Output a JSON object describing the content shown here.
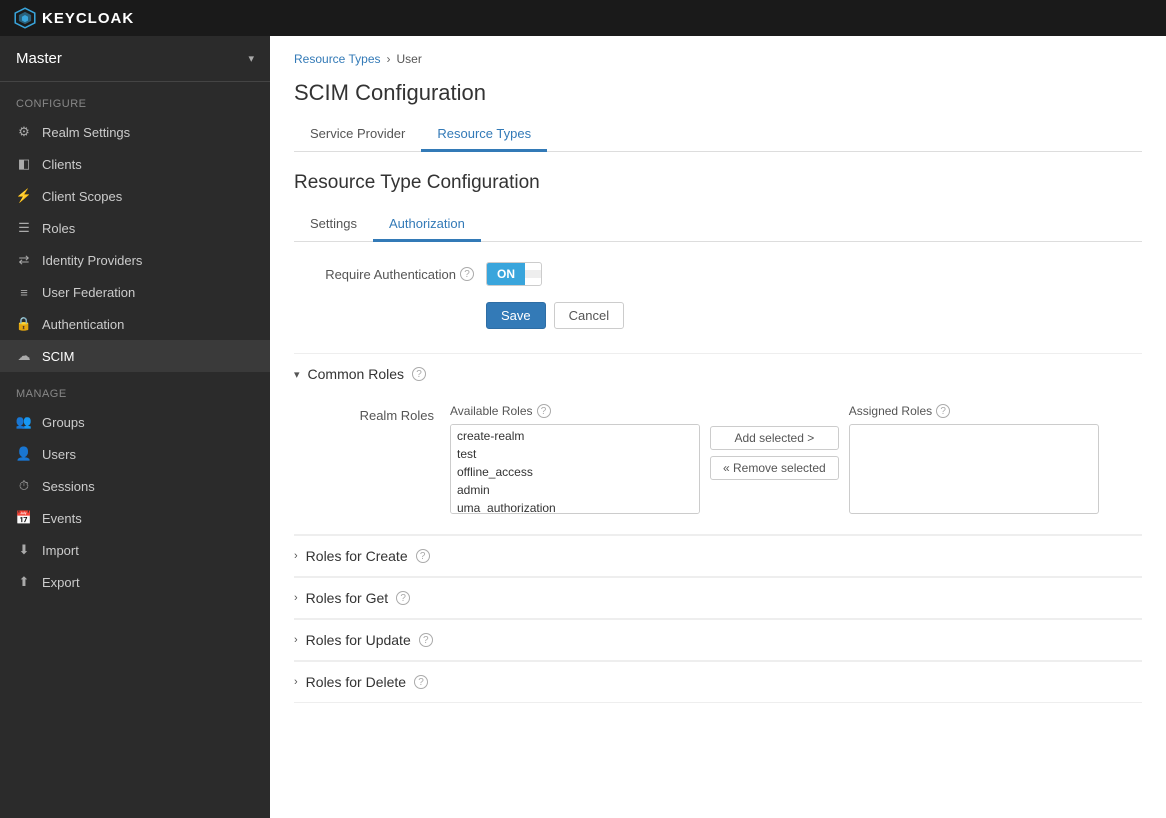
{
  "topbar": {
    "logo_text": "KEYCLOAK"
  },
  "sidebar": {
    "realm": "Master",
    "sections": {
      "configure": {
        "label": "Configure",
        "items": [
          {
            "id": "realm-settings",
            "label": "Realm Settings",
            "icon": "⚙"
          },
          {
            "id": "clients",
            "label": "Clients",
            "icon": "◧"
          },
          {
            "id": "client-scopes",
            "label": "Client Scopes",
            "icon": "🔧"
          },
          {
            "id": "roles",
            "label": "Roles",
            "icon": "☰"
          },
          {
            "id": "identity-providers",
            "label": "Identity Providers",
            "icon": "⇄"
          },
          {
            "id": "user-federation",
            "label": "User Federation",
            "icon": "≡"
          },
          {
            "id": "authentication",
            "label": "Authentication",
            "icon": "🔒"
          },
          {
            "id": "scim",
            "label": "SCIM",
            "icon": "☁",
            "active": true
          }
        ]
      },
      "manage": {
        "label": "Manage",
        "items": [
          {
            "id": "groups",
            "label": "Groups",
            "icon": "👥"
          },
          {
            "id": "users",
            "label": "Users",
            "icon": "👤"
          },
          {
            "id": "sessions",
            "label": "Sessions",
            "icon": "⏱"
          },
          {
            "id": "events",
            "label": "Events",
            "icon": "📅"
          },
          {
            "id": "import",
            "label": "Import",
            "icon": "⬇"
          },
          {
            "id": "export",
            "label": "Export",
            "icon": "⬆"
          }
        ]
      }
    }
  },
  "breadcrumb": {
    "items": [
      {
        "label": "Resource Types",
        "link": true
      },
      {
        "label": "User",
        "link": false
      }
    ]
  },
  "page": {
    "title": "SCIM Configuration",
    "tabs": [
      {
        "id": "service-provider",
        "label": "Service Provider"
      },
      {
        "id": "resource-types",
        "label": "Resource Types",
        "active": true
      }
    ],
    "section_title": "Resource Type Configuration",
    "inner_tabs": [
      {
        "id": "settings",
        "label": "Settings"
      },
      {
        "id": "authorization",
        "label": "Authorization",
        "active": true
      }
    ]
  },
  "authorization": {
    "require_auth_label": "Require Authentication",
    "toggle_on": "ON",
    "toggle_off": "",
    "save_label": "Save",
    "cancel_label": "Cancel"
  },
  "common_roles": {
    "title": "Common Roles",
    "realm_roles_label": "Realm Roles",
    "available_roles_label": "Available Roles",
    "assigned_roles_label": "Assigned Roles",
    "available_roles": [
      "create-realm",
      "test",
      "offline_access",
      "admin",
      "uma_authorization"
    ],
    "assigned_roles": [],
    "add_selected_label": "Add selected >",
    "remove_selected_label": "« Remove selected"
  },
  "collapsible_sections": [
    {
      "id": "roles-for-create",
      "label": "Roles for Create"
    },
    {
      "id": "roles-for-get",
      "label": "Roles for Get"
    },
    {
      "id": "roles-for-update",
      "label": "Roles for Update"
    },
    {
      "id": "roles-for-delete",
      "label": "Roles for Delete"
    }
  ]
}
